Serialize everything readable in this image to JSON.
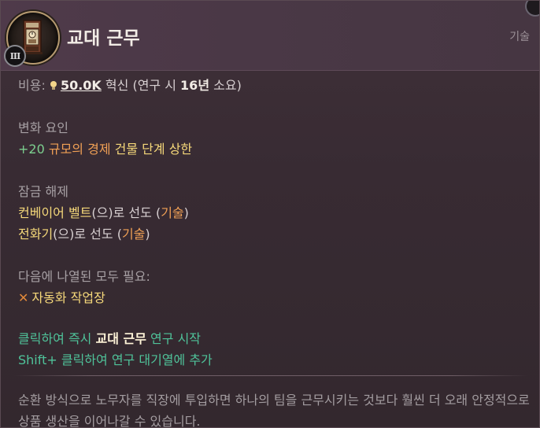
{
  "header": {
    "title": "교대 근무",
    "category": "기술",
    "tier": "III"
  },
  "cost": {
    "label": "비용:",
    "amount": "50.0K",
    "resource": "혁신",
    "paren_open": "(연구 시",
    "weeks": "16년",
    "paren_close": "소요)"
  },
  "modifiers": {
    "heading": "변화 요인",
    "value": "+20",
    "name": "규모의 경제",
    "rest": "건물 단계 상한"
  },
  "unlocks": {
    "heading": "잠금 해제",
    "items": [
      {
        "name": "컨베이어 벨트",
        "suffix": "(으)로 선도 (",
        "kind": "기술",
        "close": ")"
      },
      {
        "name": "전화기",
        "suffix": "(으)로 선도 (",
        "kind": "기술",
        "close": ")"
      }
    ]
  },
  "requires": {
    "heading": "다음에 나열된 모두 필요:",
    "item": "자동화 작업장"
  },
  "actions": {
    "click_prefix": "클릭하여 즉시",
    "click_target": "교대 근무",
    "click_suffix": "연구 시작",
    "shift_click": "Shift+ 클릭하여 연구 대기열에 추가"
  },
  "flavor": "순환 방식으로 노무자를 직장에 투입하면 하나의 팀을 근무시키는 것보다 훨씬 더 오래 안정적으로 상품 생산을 이어나갈 수 있습니다.",
  "icons": {
    "tech": "clock-tower-icon",
    "cost": "lightbulb-icon",
    "missing": "cross-icon"
  }
}
